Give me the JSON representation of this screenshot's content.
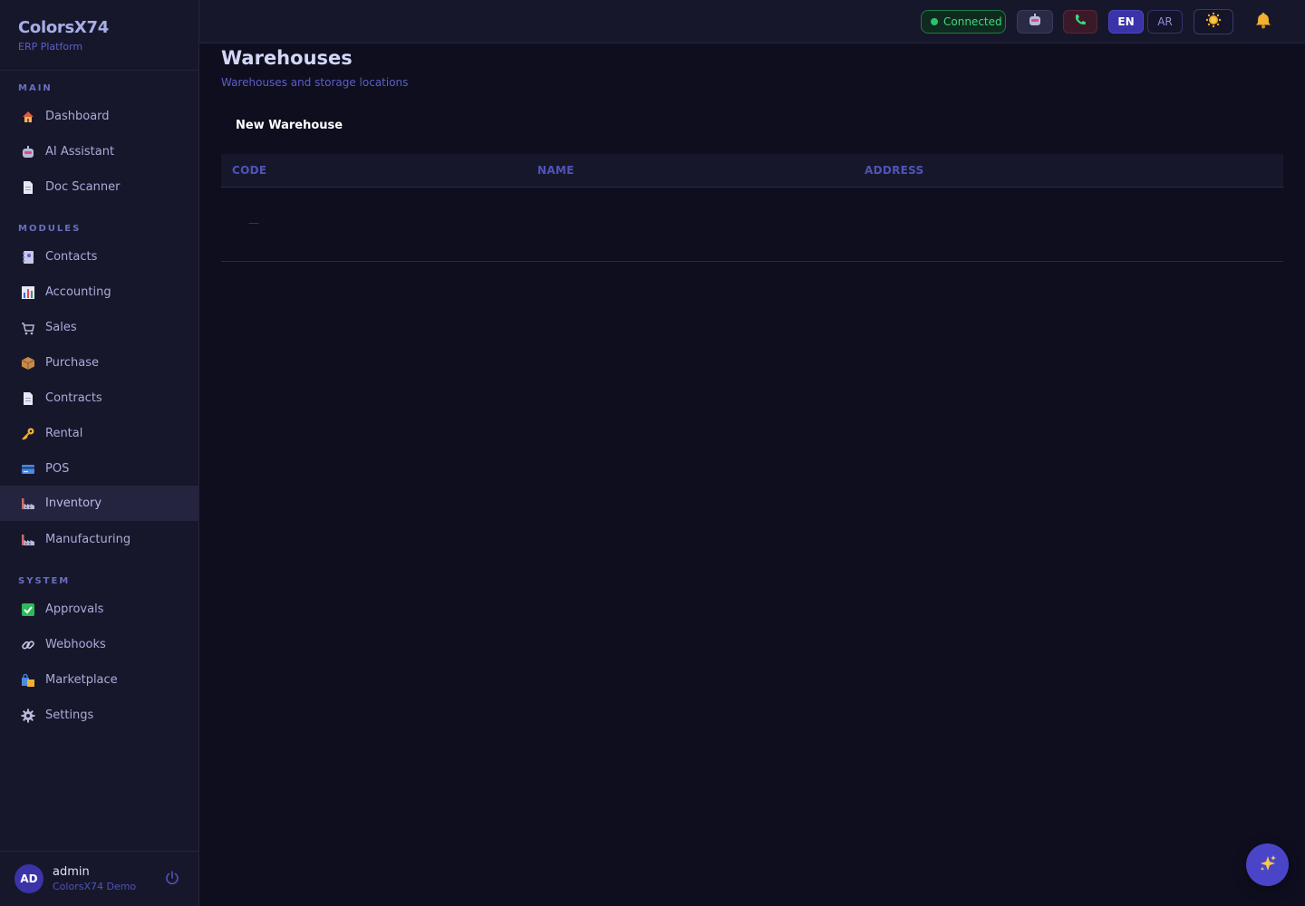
{
  "brand": {
    "title": "ColorsX74",
    "subtitle": "ERP Platform"
  },
  "sidebar": {
    "sections": {
      "main": "MAIN",
      "modules": "MODULES",
      "system": "SYSTEM"
    },
    "items": [
      {
        "label": "Dashboard",
        "icon": "house-icon"
      },
      {
        "label": "AI Assistant",
        "icon": "robot-icon"
      },
      {
        "label": "Doc Scanner",
        "icon": "document-icon"
      },
      {
        "label": "Contacts",
        "icon": "address-book-icon"
      },
      {
        "label": "Accounting",
        "icon": "bar-chart-icon"
      },
      {
        "label": "Sales",
        "icon": "cart-icon"
      },
      {
        "label": "Purchase",
        "icon": "package-icon"
      },
      {
        "label": "Contracts",
        "icon": "document-icon"
      },
      {
        "label": "Rental",
        "icon": "key-icon"
      },
      {
        "label": "POS",
        "icon": "credit-card-icon"
      },
      {
        "label": "Inventory",
        "icon": "factory-icon",
        "active": true
      },
      {
        "label": "Manufacturing",
        "icon": "factory-icon"
      },
      {
        "label": "Approvals",
        "icon": "check-box-icon"
      },
      {
        "label": "Webhooks",
        "icon": "link-icon"
      },
      {
        "label": "Marketplace",
        "icon": "shopping-bags-icon"
      },
      {
        "label": "Settings",
        "icon": "gear-icon"
      }
    ]
  },
  "user": {
    "initials": "AD",
    "name": "admin",
    "org": "ColorsX74 Demo"
  },
  "topbar": {
    "status": "Connected",
    "lang_en": "EN",
    "lang_ar": "AR"
  },
  "page": {
    "title": "Warehouses",
    "subtitle": "Warehouses and storage locations",
    "new_button": "New Warehouse"
  },
  "table": {
    "columns": [
      "CODE",
      "NAME",
      "ADDRESS"
    ],
    "rows": [
      {
        "code": "—"
      }
    ]
  },
  "colors": {
    "accent": "#3b33a8",
    "status_green": "#3fd981",
    "background": "#0e0e1f",
    "sidebar": "#17172b"
  }
}
